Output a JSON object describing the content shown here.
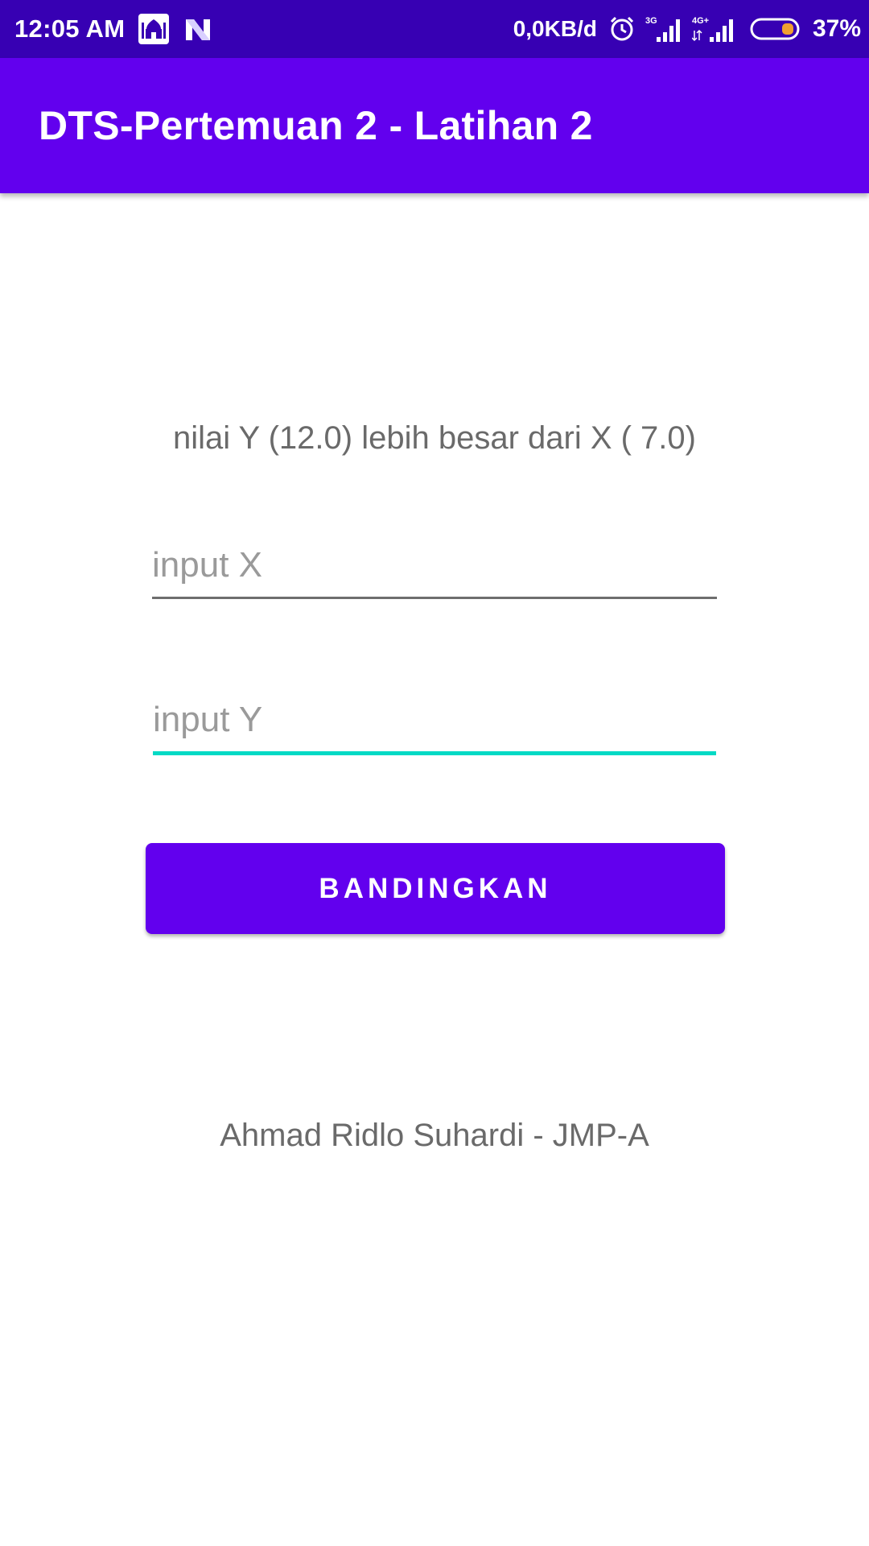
{
  "status_bar": {
    "time": "12:05 AM",
    "network_speed": "0,0KB/d",
    "signal_1_label": "3G",
    "signal_2_label": "4G+",
    "battery_percent": "37%",
    "icons": [
      "mosque-app-icon",
      "n-app-icon",
      "alarm-icon",
      "signal-icon",
      "signal-icon",
      "battery-icon"
    ]
  },
  "app_bar": {
    "title": "DTS-Pertemuan 2 - Latihan 2"
  },
  "main": {
    "result_text": "nilai Y (12.0) lebih besar dari X ( 7.0)",
    "input_x": {
      "placeholder": "input X",
      "value": ""
    },
    "input_y": {
      "placeholder": "input Y",
      "value": ""
    },
    "compare_button_label": "BANDINGKAN",
    "footer_text": "Ahmad Ridlo Suhardi - JMP-A"
  },
  "colors": {
    "status_bar": "#3700B3",
    "primary": "#6200EE",
    "accent": "#03DAC5"
  }
}
